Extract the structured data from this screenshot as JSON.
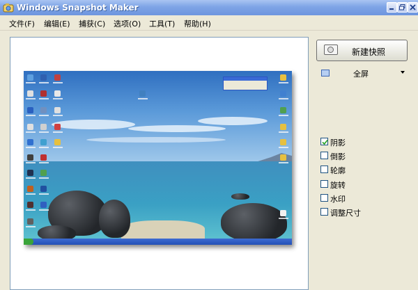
{
  "window": {
    "title": "Windows Snapshot Maker"
  },
  "menu": [
    {
      "label": "文件(F)"
    },
    {
      "label": "编辑(E)"
    },
    {
      "label": "捕获(C)"
    },
    {
      "label": "选项(O)"
    },
    {
      "label": "工具(T)"
    },
    {
      "label": "帮助(H)"
    }
  ],
  "panel": {
    "new_snapshot_label": "新建快照",
    "capture_mode": "全屏",
    "options": [
      {
        "label": "阴影",
        "checked": true
      },
      {
        "label": "倒影",
        "checked": false
      },
      {
        "label": "轮廓",
        "checked": false
      },
      {
        "label": "旋转",
        "checked": false
      },
      {
        "label": "水印",
        "checked": false
      },
      {
        "label": "调整尺寸",
        "checked": false
      }
    ]
  },
  "colors": {
    "titlebar": "#7ea4e6",
    "window_bg": "#ece9d8",
    "preview_border": "#7f9db9"
  }
}
